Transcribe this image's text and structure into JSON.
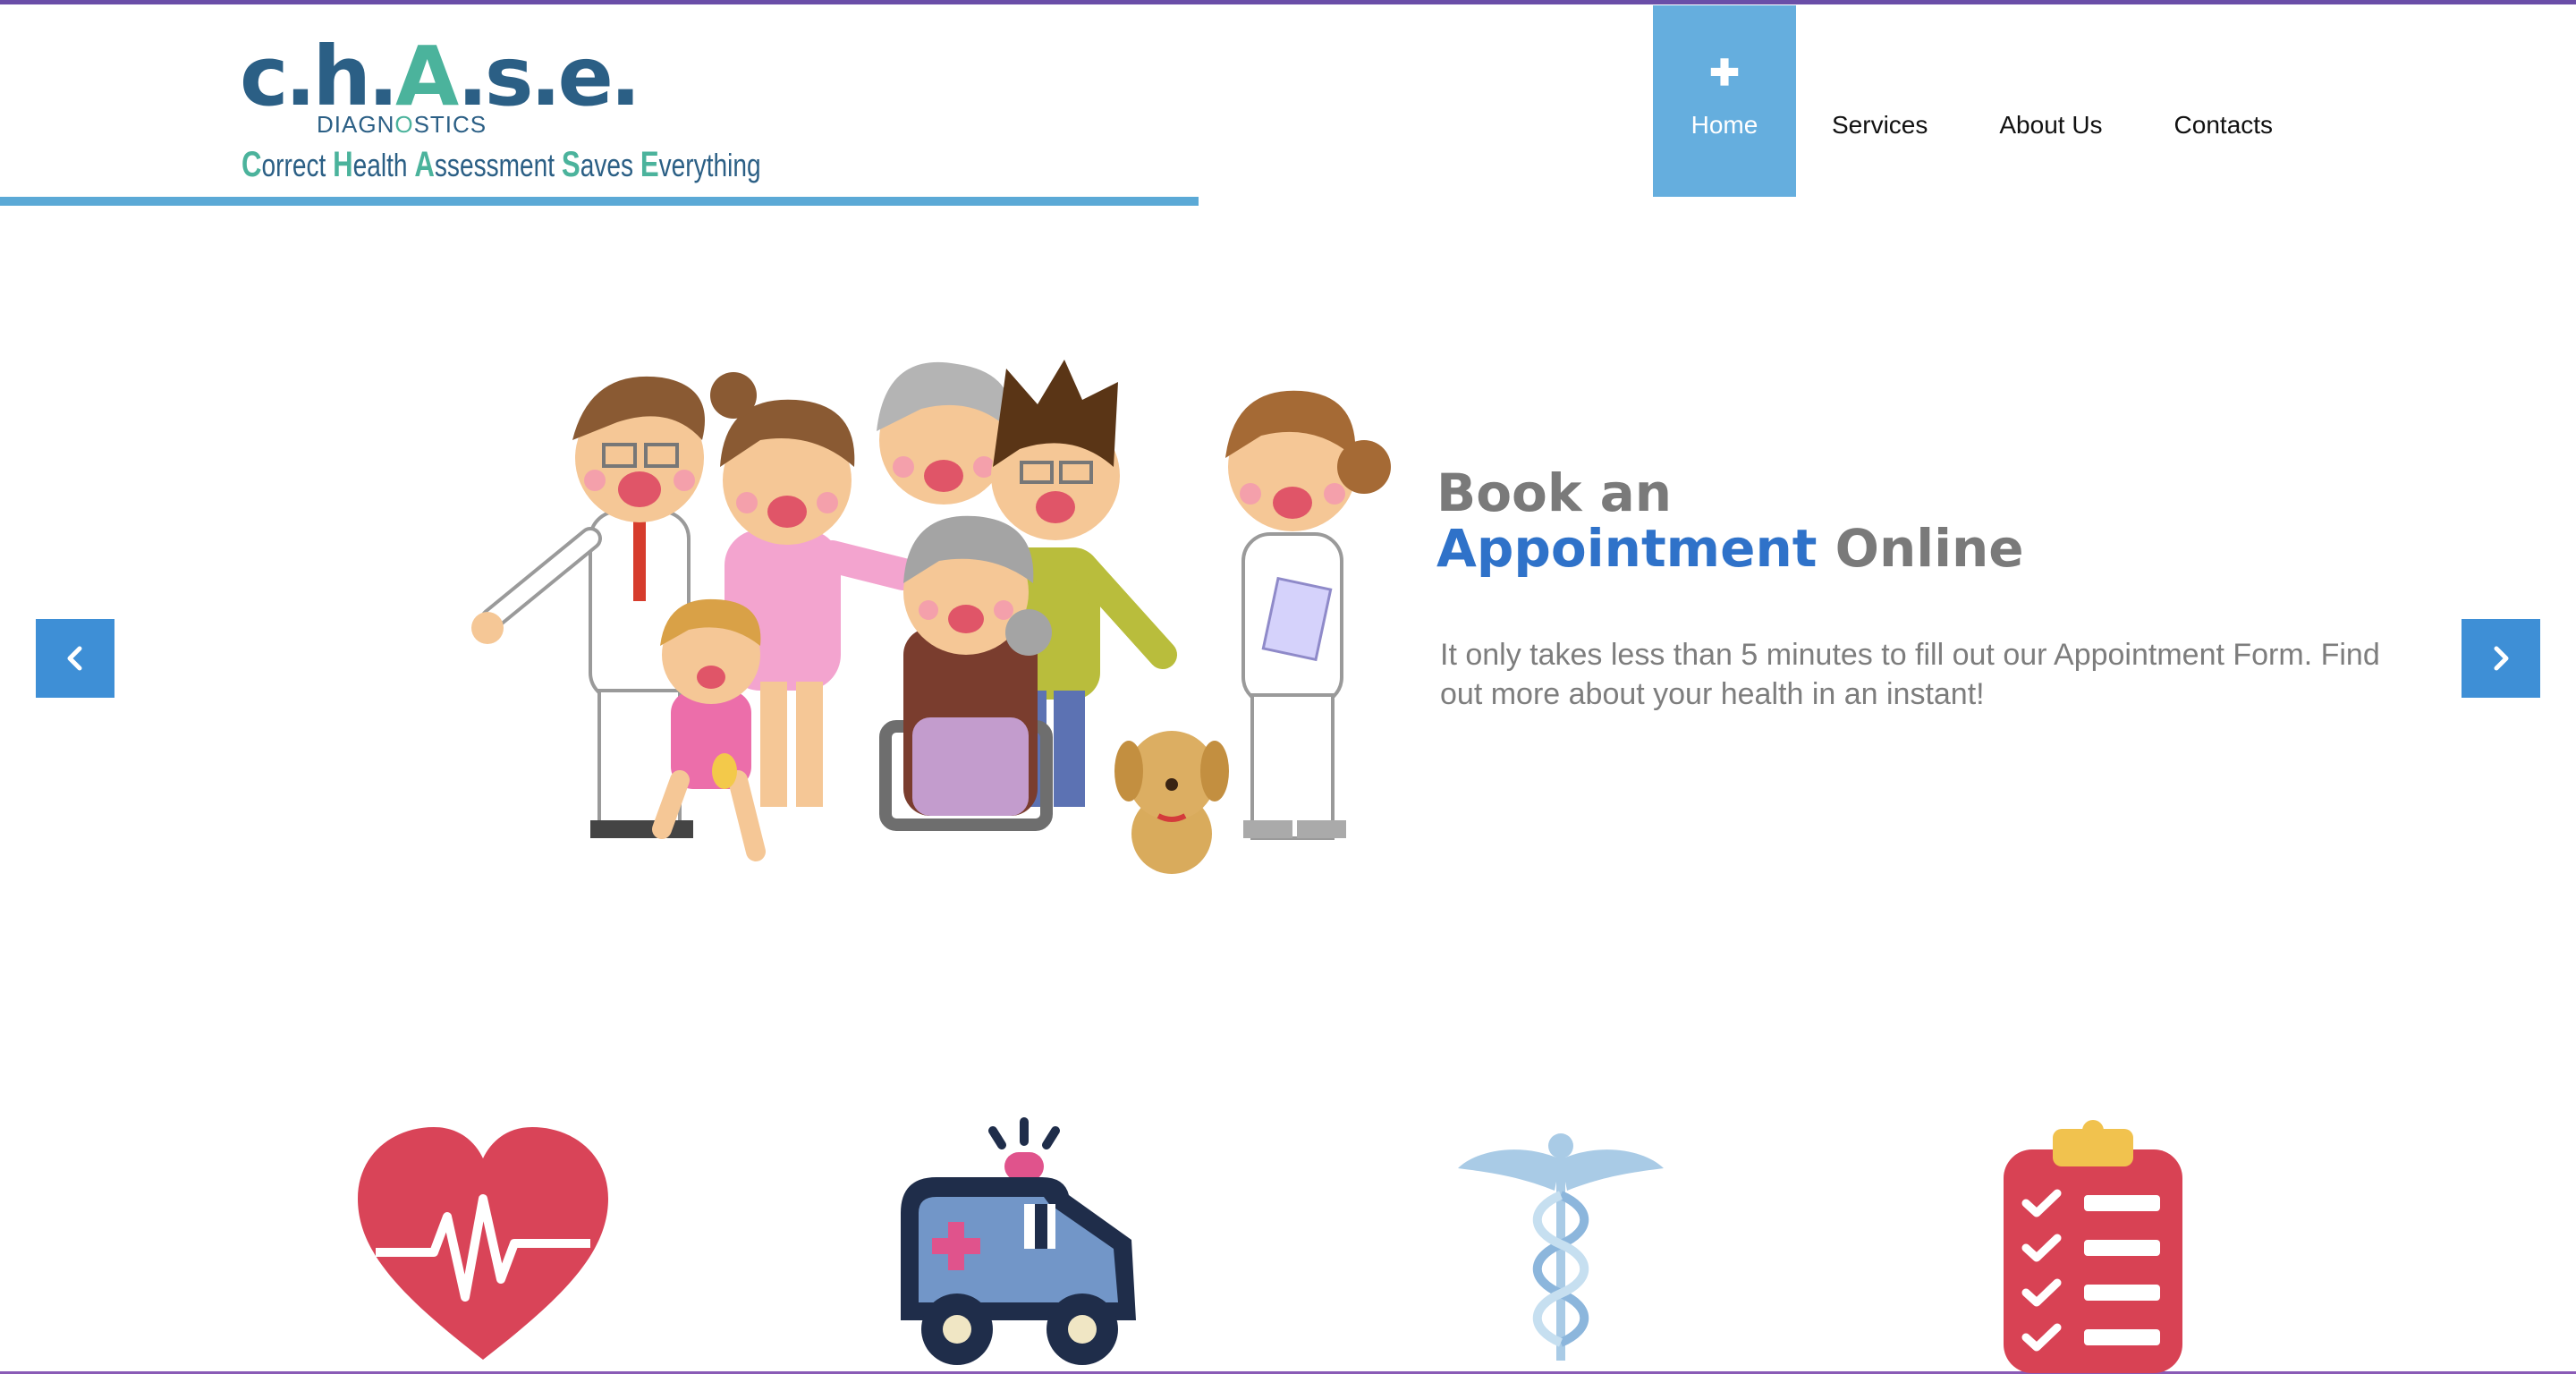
{
  "colors": {
    "top_accent": "#6a4ea8",
    "bottom_accent": "#8a5bb6",
    "logo_dark": "#2b5f85",
    "logo_teal": "#4bb39c",
    "underline": "#5ba9d6",
    "nav_active": "#65aede",
    "hero_blue": "#2f72c9",
    "hero_gray": "#7a7a7a",
    "arrow_bg": "#3e8fd6"
  },
  "logo": {
    "word_1": "c.h.",
    "word_a": "A",
    "word_2": ".s.e.",
    "sub_1": "DIAGN",
    "sub_o": "O",
    "sub_2": "STICS",
    "tagline": [
      {
        "cap": "C",
        "rest": "orrect "
      },
      {
        "cap": "H",
        "rest": "ealth "
      },
      {
        "cap": "A",
        "rest": "ssessment "
      },
      {
        "cap": "S",
        "rest": "aves "
      },
      {
        "cap": "E",
        "rest": "verything"
      }
    ]
  },
  "nav": {
    "active_icon": "plus-icon",
    "items": [
      {
        "label": "Home",
        "active": true
      },
      {
        "label": "Services",
        "active": false
      },
      {
        "label": "About Us",
        "active": false
      },
      {
        "label": "Contacts",
        "active": false
      }
    ]
  },
  "hero": {
    "title_line1": "Book an",
    "title_highlight": "Appointment",
    "title_rest": " Online",
    "description": "It only takes less than 5 minutes to fill out our Appointment Form. Find out more about your health in an instant!",
    "illustration": "family-doctor-nurse-illustration"
  },
  "slider": {
    "prev_icon": "chevron-left-icon",
    "next_icon": "chevron-right-icon"
  },
  "features": [
    {
      "icon": "heartbeat-icon"
    },
    {
      "icon": "ambulance-icon"
    },
    {
      "icon": "caduceus-icon"
    },
    {
      "icon": "clipboard-checklist-icon"
    }
  ]
}
